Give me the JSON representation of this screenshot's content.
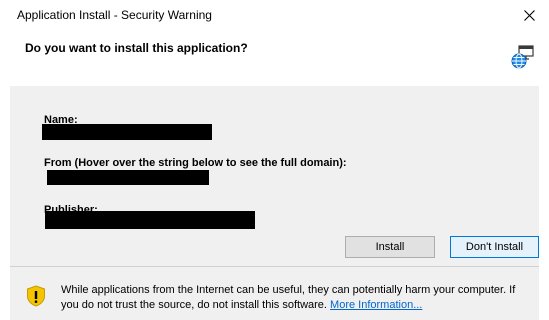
{
  "window": {
    "title": "Application Install - Security Warning",
    "close_icon": "close-icon"
  },
  "question": "Do you want to install this application?",
  "app_icon": "globe-application-icon",
  "fields": {
    "name_label": "Name:",
    "from_label": "From (Hover over the string below to see the full domain):",
    "publisher_label": "Publisher:"
  },
  "buttons": {
    "install": "Install",
    "dont_install": "Don't Install"
  },
  "warning": {
    "icon": "shield-warning-icon",
    "text": "While applications from the Internet can be useful, they can potentially harm your computer. If you do not trust the source, do not install this software.",
    "link": "More Information..."
  },
  "colors": {
    "panel": "#f0f0f0",
    "default_button_border": "#0078d7",
    "link": "#0066cc",
    "shield_yellow": "#f5c400"
  }
}
